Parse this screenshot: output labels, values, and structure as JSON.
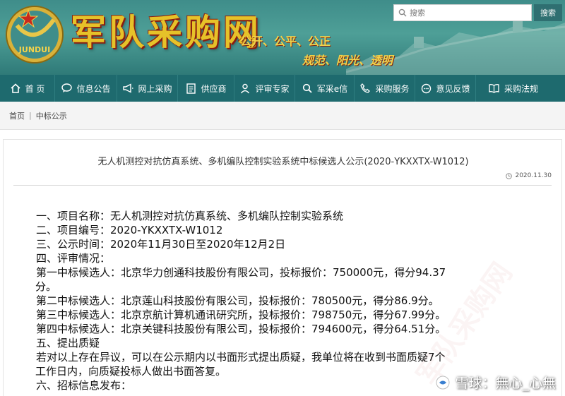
{
  "header": {
    "logo_text": "JUNDUI",
    "site_title": "军队采购网",
    "slogan_line1": "公开、公平、公正",
    "slogan_line2": "规范、阳光、透明",
    "search_placeholder": "搜索",
    "search_button": "搜索"
  },
  "nav": {
    "items": [
      {
        "label": "首 页",
        "icon": "home-icon"
      },
      {
        "label": "信息公告",
        "icon": "chat-icon"
      },
      {
        "label": "网上采购",
        "icon": "megaphone-icon"
      },
      {
        "label": "供应商",
        "icon": "document-icon"
      },
      {
        "label": "评审专家",
        "icon": "user-icon"
      },
      {
        "label": "军采e信",
        "icon": "search-icon"
      },
      {
        "label": "采购服务",
        "icon": "phone-icon"
      },
      {
        "label": "意见反馈",
        "icon": "comment-icon"
      },
      {
        "label": "采购法规",
        "icon": "book-icon"
      }
    ]
  },
  "breadcrumb": {
    "home": "首页",
    "current": "中标公示"
  },
  "article": {
    "title": "无人机测控对抗仿真系统、多机编队控制实验系统中标候选人公示(2020-YKXXTX-W1012)",
    "date": "2020.11.30",
    "lines": [
      "一、项目名称：无人机测控对抗仿真系统、多机编队控制实验系统",
      "二、项目编号：2020-YKXXTX-W1012",
      "三、公示时间：2020年11月30日至2020年12月2日",
      "四、评审情况：",
      "第一中标候选人：北京华力创通科技股份有限公司，投标报价：750000元，得分94.37",
      "分。",
      "第二中标候选人：北京莲山科技股份有限公司，投标报价：780500元，得分86.9分。",
      "第三中标候选人：北京京航计算机通讯研究所，投标报价：798750元，得分67.99分。",
      "第四中标候选人：北京关键科技股份有限公司，投标报价：794600元，得分64.51分。",
      "五、提出质疑",
      "若对以上存在异议，可以在公示期内以书面形式提出质疑，我单位将在收到书面质疑7个",
      "工作日内，向质疑投标人做出书面答复。",
      "六、招标信息发布："
    ]
  },
  "watermark": {
    "text": "雪球：無心_心無"
  },
  "colors": {
    "header_teal": "#4e9f97",
    "nav_bg": "#1e6a6e",
    "title_gold": "#e6c229",
    "logo_red": "#c8281e"
  }
}
